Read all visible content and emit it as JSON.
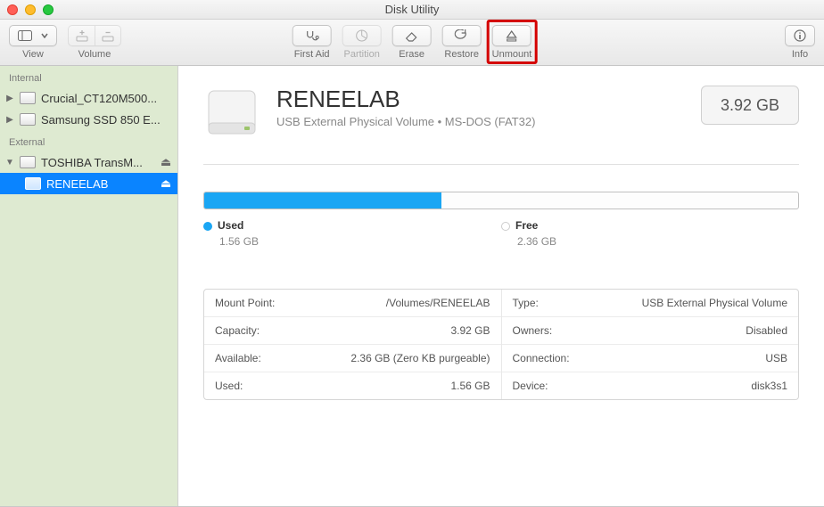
{
  "window": {
    "title": "Disk Utility"
  },
  "toolbar": {
    "view": "View",
    "volume": "Volume",
    "first_aid": "First Aid",
    "partition": "Partition",
    "erase": "Erase",
    "restore": "Restore",
    "unmount": "Unmount",
    "info": "Info"
  },
  "sidebar": {
    "sections": [
      {
        "header": "Internal",
        "items": [
          {
            "label": "Crucial_CT120M500...",
            "expandable": true
          },
          {
            "label": "Samsung SSD 850 E...",
            "expandable": true
          }
        ]
      },
      {
        "header": "External",
        "items": [
          {
            "label": "TOSHIBA TransM...",
            "expandable": true,
            "expanded": true,
            "ejectable": true,
            "children": [
              {
                "label": "RENEELAB",
                "selected": true,
                "ejectable": true
              }
            ]
          }
        ]
      }
    ]
  },
  "volume": {
    "name": "RENEELAB",
    "subtitle": "USB External Physical Volume • MS-DOS (FAT32)",
    "size_badge": "3.92 GB",
    "usage": {
      "used_label": "Used",
      "used_value": "1.56 GB",
      "free_label": "Free",
      "free_value": "2.36 GB",
      "used_pct": 40
    },
    "details_left": [
      {
        "key": "Mount Point:",
        "value": "/Volumes/RENEELAB"
      },
      {
        "key": "Capacity:",
        "value": "3.92 GB"
      },
      {
        "key": "Available:",
        "value": "2.36 GB (Zero KB purgeable)"
      },
      {
        "key": "Used:",
        "value": "1.56 GB"
      }
    ],
    "details_right": [
      {
        "key": "Type:",
        "value": "USB External Physical Volume"
      },
      {
        "key": "Owners:",
        "value": "Disabled"
      },
      {
        "key": "Connection:",
        "value": "USB"
      },
      {
        "key": "Device:",
        "value": "disk3s1"
      }
    ]
  },
  "colors": {
    "accent": "#0a84ff",
    "bar_used": "#1aa6f4"
  }
}
